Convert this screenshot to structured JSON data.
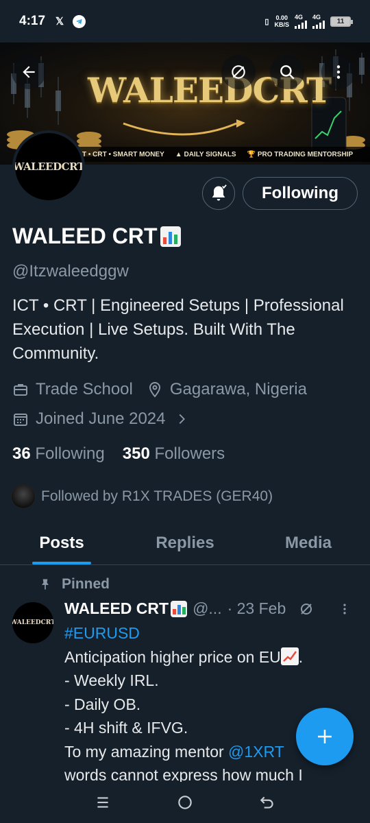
{
  "status_bar": {
    "time": "4:17",
    "data_speed_value": "0.00",
    "data_speed_unit": "KB/S",
    "network_1": "4G",
    "network_2": "4G",
    "battery_level": "11"
  },
  "banner": {
    "brand": "WALEEDCRT",
    "tagline_1": "T • CRT • SMART MONEY",
    "tagline_2": "DAILY SIGNALS",
    "tagline_3": "PRO TRADING MENTORSHIP"
  },
  "avatar_text": "WALEEDCRT",
  "profile": {
    "display_name": "WALEED CRT",
    "handle": "@Itzwaleedggw",
    "bio": "ICT • CRT | Engineered Setups | Professional Execution | Live Setups. Built With The Community.",
    "category": "Trade School",
    "location": "Gagarawa, Nigeria",
    "joined": "Joined June 2024",
    "following_count": "36",
    "following_label": "Following",
    "followers_count": "350",
    "followers_label": "Followers",
    "followed_by": "Followed by R1X TRADES (GER40)",
    "follow_button": "Following"
  },
  "tabs": [
    "Posts",
    "Replies",
    "Media"
  ],
  "pinned_post": {
    "pinned_label": "Pinned",
    "author_name": "WALEED CRT",
    "author_handle": "@...",
    "date": "· 23 Feb",
    "hashtag": "#EURUSD",
    "line_1": "Anticipation higher price on EU",
    "line_2": "- Weekly IRL.",
    "line_3": "- Daily OB.",
    "line_4": "- 4H shift & IFVG.",
    "line_5_prefix": "To my amazing mentor ",
    "line_5_mention": "@1XRT",
    "line_6": "words cannot express how much I"
  },
  "colors": {
    "background": "#15202b",
    "accent": "#1d9bf0",
    "secondary_text": "#8b98a5"
  },
  "icons": [
    "back-arrow-icon",
    "grok-icon",
    "search-icon",
    "more-vertical-icon",
    "notification-bell-icon",
    "briefcase-icon",
    "location-pin-icon",
    "calendar-icon",
    "chevron-right-icon",
    "pin-icon",
    "plus-icon"
  ]
}
